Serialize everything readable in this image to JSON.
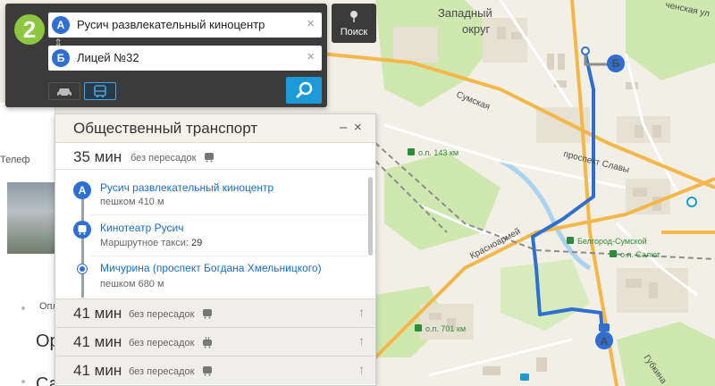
{
  "app": {
    "logo_text": "2"
  },
  "search": {
    "from_badge": "А",
    "from_value": "Русич развлекательный киноцентр",
    "to_badge": "Б",
    "to_value": "Лицей №32",
    "clear_glyph": "×",
    "tab_label": "Поиск"
  },
  "panel": {
    "title": "Общественный транспорт",
    "minimize": "–",
    "close": "×",
    "selected_route": {
      "time": "35 мин",
      "transfers": "без пересадок",
      "steps": [
        {
          "name": "Русич развлекательный киноцентр",
          "detail": "пешком 410 м"
        },
        {
          "name": "Кинотеатр Русич",
          "detail": "Маршрутное такси:",
          "route_num": "29"
        },
        {
          "name": "Мичурина (проспект Богдана Хмельницкого)",
          "detail": "пешком 680 м"
        }
      ],
      "start_badge": "А"
    },
    "alternatives": [
      {
        "time": "41 мин",
        "transfers": "без пересадок",
        "icon": "bus-icon"
      },
      {
        "time": "41 мин",
        "transfers": "без пересадок",
        "icon": "trolleybus-icon"
      },
      {
        "time": "41 мин",
        "transfers": "без пересадок",
        "icon": "bus-icon"
      }
    ],
    "expand_glyph": "↑"
  },
  "sidebar": {
    "label_1": "Телеф",
    "label_2": "Опл",
    "label_3": "Ор",
    "label_4": "Са"
  },
  "map": {
    "district": "Западный\nокруг",
    "district_line1": "Западный",
    "district_line2": "округ",
    "top_right": "ченская ул",
    "streets": {
      "sumskaya": "Сумская",
      "slavy": "проспект Славы",
      "krasnoarm": "Красноармей",
      "gubkina": "Губкина"
    },
    "stops": {
      "op143": "о.п. 143 км",
      "belgorod": "Белгород-Сумской",
      "salyut": "о.п. Салют",
      "op701": "о.п. 701 км"
    },
    "point_a": "А",
    "point_b": "Б"
  },
  "colors": {
    "route": "#2f6fd1",
    "accent": "#1a9ad6",
    "road_major": "#f5b74a",
    "park": "#c9e6a5",
    "water": "#a9d3ee",
    "logo": "#8dc63f"
  }
}
